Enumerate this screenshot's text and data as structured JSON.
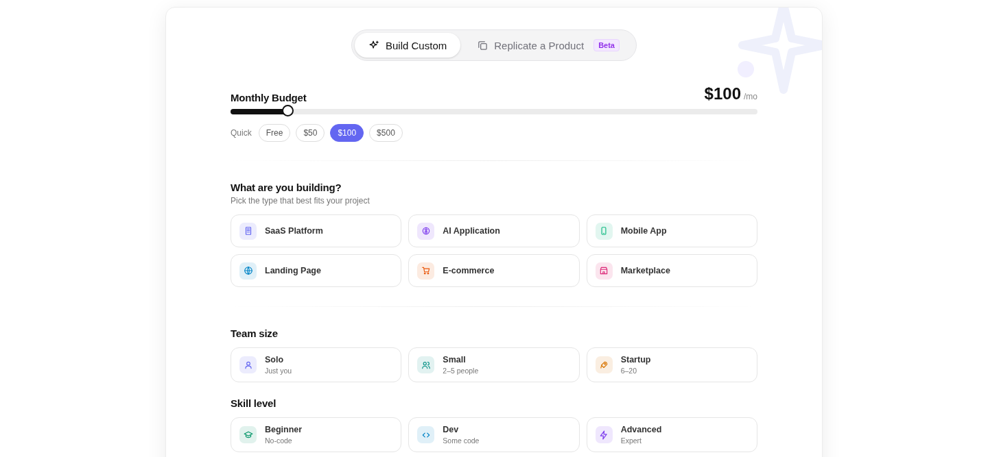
{
  "mode_tabs": [
    {
      "label": "Build Custom",
      "selected": true
    },
    {
      "label": "Replicate a Product",
      "selected": false,
      "badge": "Beta"
    }
  ],
  "budget": {
    "label": "Monthly Budget",
    "amount": "$100",
    "unit": "/mo",
    "level": 0.11,
    "quick_label": "Quick",
    "quick_options": [
      {
        "label": "Free",
        "selected": false
      },
      {
        "label": "$50",
        "selected": false
      },
      {
        "label": "$100",
        "selected": true
      },
      {
        "label": "$500",
        "selected": false
      }
    ]
  },
  "project_type": {
    "title": "What are you building?",
    "subtitle": "Pick the type that best fits your project",
    "options": [
      {
        "label": "SaaS Platform",
        "selected": false
      },
      {
        "label": "AI Application",
        "selected": false
      },
      {
        "label": "Mobile App",
        "selected": false
      },
      {
        "label": "Landing Page",
        "selected": false
      },
      {
        "label": "E-commerce",
        "selected": false
      },
      {
        "label": "Marketplace",
        "selected": false
      }
    ]
  },
  "team_size": {
    "title": "Team size",
    "options": [
      {
        "label": "Solo",
        "sublabel": "Just you",
        "selected": false
      },
      {
        "label": "Small",
        "sublabel": "2–5 people",
        "selected": false
      },
      {
        "label": "Startup",
        "sublabel": "6–20",
        "selected": false
      }
    ]
  },
  "skill_level": {
    "title": "Skill level",
    "options": [
      {
        "label": "Beginner",
        "sublabel": "No-code",
        "selected": false
      },
      {
        "label": "Dev",
        "sublabel": "Some code",
        "selected": false
      },
      {
        "label": "Advanced",
        "sublabel": "Expert",
        "selected": false
      }
    ]
  }
}
